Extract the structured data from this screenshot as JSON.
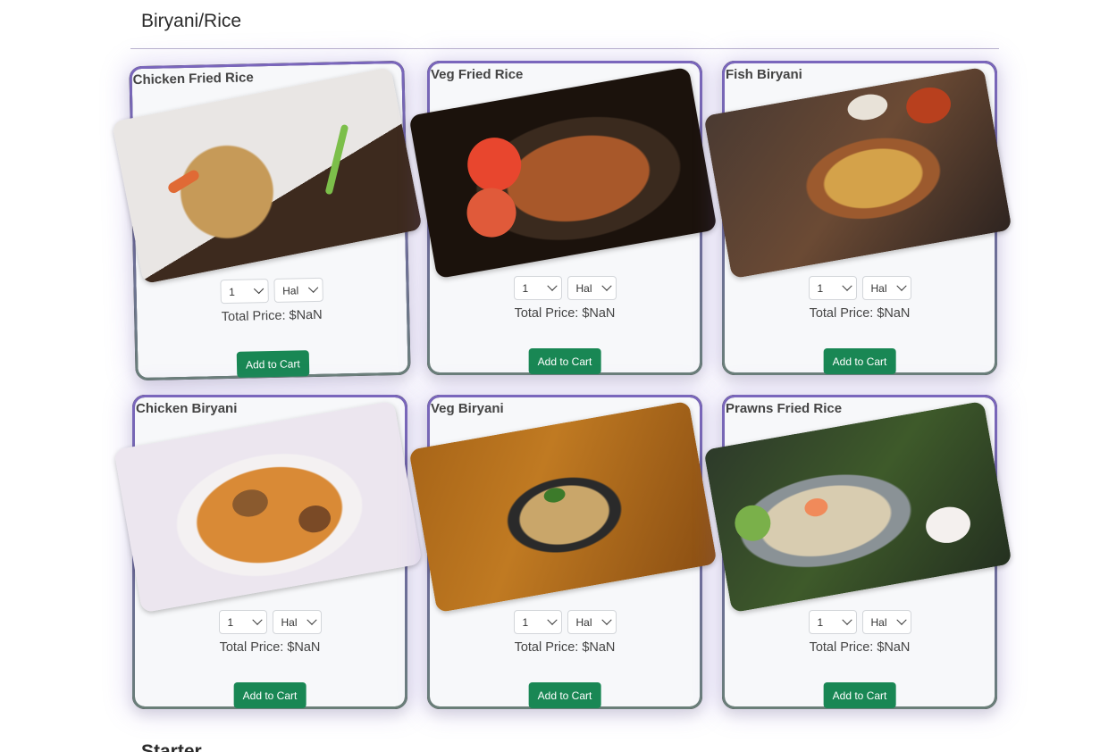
{
  "section": {
    "title": "Biryani/Rice",
    "next_title": "Starter"
  },
  "items": [
    {
      "name": "Chicken Fried Rice",
      "quantity": "1",
      "size": "Hal",
      "price_text": "Total Price: $NaN",
      "button_label": "Add to Cart",
      "img_colors": {
        "bg": "#3d2a1e",
        "plate": "#e9e6e4",
        "food": "#c69a58",
        "accent": "#e06a35"
      }
    },
    {
      "name": "Veg Fried Rice",
      "quantity": "1",
      "size": "Hal",
      "price_text": "Total Price: $NaN",
      "button_label": "Add to Cart",
      "img_colors": {
        "bg": "#1b120c",
        "plate": "#3a2a1e",
        "food": "#a8582a",
        "accent": "#e8462e"
      }
    },
    {
      "name": "Fish Biryani",
      "quantity": "1",
      "size": "Hal",
      "price_text": "Total Price: $NaN",
      "button_label": "Add to Cart",
      "img_colors": {
        "bg": "#4a3a32",
        "plate": "#9c5a2e",
        "food": "#d4a24a",
        "accent": "#b8401e"
      }
    },
    {
      "name": "Chicken Biryani",
      "quantity": "1",
      "size": "Hal",
      "price_text": "Total Price: $NaN",
      "button_label": "Add to Cart",
      "img_colors": {
        "bg": "#ece6ef",
        "plate": "#f4f1f2",
        "food": "#d98a36",
        "accent": "#8a5a2e"
      }
    },
    {
      "name": "Veg Biryani",
      "quantity": "1",
      "size": "Hal",
      "price_text": "Total Price: $NaN",
      "button_label": "Add to Cart",
      "img_colors": {
        "bg": "#a86518",
        "plate": "#2a2a2a",
        "food": "#c9a66a",
        "accent": "#3c7a2a"
      }
    },
    {
      "name": "Prawns Fried Rice",
      "quantity": "1",
      "size": "Hal",
      "price_text": "Total Price: $NaN",
      "button_label": "Add to Cart",
      "img_colors": {
        "bg": "#2d3a2a",
        "plate": "#8a9296",
        "food": "#d8ccb0",
        "accent": "#f08a5a"
      }
    }
  ]
}
